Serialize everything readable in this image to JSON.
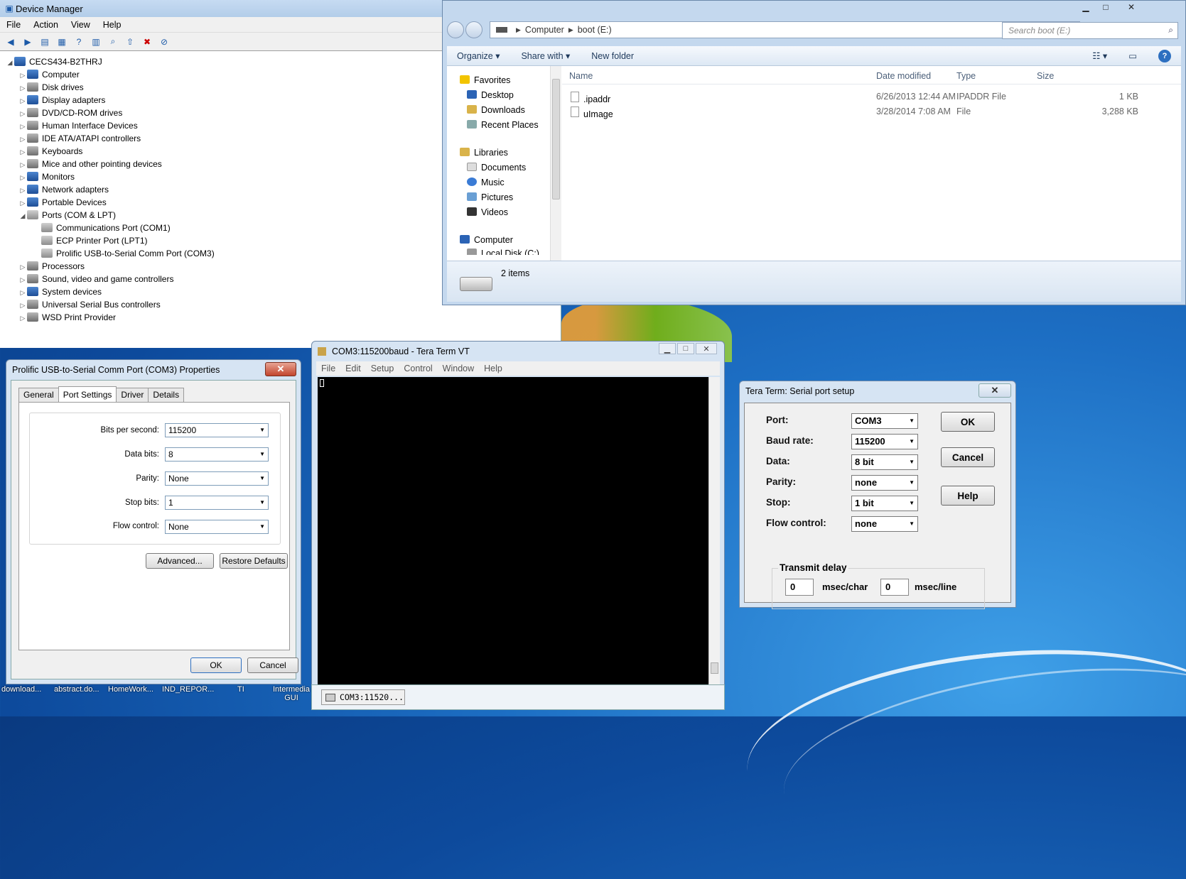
{
  "desktop": {
    "icons": [
      {
        "label": "download..."
      },
      {
        "label": "abstract.do..."
      },
      {
        "label": "HomeWork..."
      },
      {
        "label": "IND_REPOR..."
      },
      {
        "label": "TI"
      },
      {
        "label": "Intermedia GUI"
      }
    ]
  },
  "device_manager": {
    "title": "Device Manager",
    "menu": [
      "File",
      "Action",
      "View",
      "Help"
    ],
    "toolbar_icons": [
      "back-icon",
      "forward-icon",
      "up-icon",
      "properties-icon",
      "help-icon",
      "details-icon",
      "scan-icon",
      "update-driver-icon",
      "uninstall-icon",
      "disable-icon"
    ],
    "root": "CECS434-B2THRJ",
    "categories": [
      "Computer",
      "Disk drives",
      "Display adapters",
      "DVD/CD-ROM drives",
      "Human Interface Devices",
      "IDE ATA/ATAPI controllers",
      "Keyboards",
      "Mice and other pointing devices",
      "Monitors",
      "Network adapters",
      "Portable Devices",
      "Ports (COM & LPT)"
    ],
    "ports": [
      "Communications Port (COM1)",
      "ECP Printer Port (LPT1)",
      "Prolific USB-to-Serial Comm Port (COM3)"
    ],
    "categories_after": [
      "Processors",
      "Sound, video and game controllers",
      "System devices",
      "Universal Serial Bus controllers",
      "WSD Print Provider"
    ]
  },
  "explorer": {
    "breadcrumb": [
      "Computer",
      "boot (E:)"
    ],
    "search_placeholder": "Search boot (E:)",
    "commands": [
      "Organize ▾",
      "Share with ▾",
      "New folder"
    ],
    "nav": {
      "favorites": "Favorites",
      "favorite_items": [
        "Desktop",
        "Downloads",
        "Recent Places"
      ],
      "libraries": "Libraries",
      "library_items": [
        "Documents",
        "Music",
        "Pictures",
        "Videos"
      ],
      "computer": "Computer",
      "computer_items": [
        "Local Disk (C:)"
      ]
    },
    "columns": [
      "Name",
      "Date modified",
      "Type",
      "Size"
    ],
    "files": [
      {
        "name": ".ipaddr",
        "date": "6/26/2013 12:44 AM",
        "type": "IPADDR File",
        "size": "1 KB"
      },
      {
        "name": "uImage",
        "date": "3/28/2014 7:08 AM",
        "type": "File",
        "size": "3,288 KB"
      }
    ],
    "status": "2 items"
  },
  "properties": {
    "title": "Prolific USB-to-Serial Comm Port (COM3) Properties",
    "tabs": [
      "General",
      "Port Settings",
      "Driver",
      "Details"
    ],
    "active_tab": "Port Settings",
    "fields": [
      {
        "label": "Bits per second:",
        "value": "115200"
      },
      {
        "label": "Data bits:",
        "value": "8"
      },
      {
        "label": "Parity:",
        "value": "None"
      },
      {
        "label": "Stop bits:",
        "value": "1"
      },
      {
        "label": "Flow control:",
        "value": "None"
      }
    ],
    "advanced": "Advanced...",
    "restore": "Restore Defaults",
    "ok": "OK",
    "cancel": "Cancel",
    "close": "✕"
  },
  "teraterm": {
    "title": "COM3:115200baud - Tera Term VT",
    "menu": [
      "File",
      "Edit",
      "Setup",
      "Control",
      "Window",
      "Help"
    ],
    "taskbar_label": "COM3:11520..."
  },
  "serial_setup": {
    "title": "Tera Term: Serial port setup",
    "fields": [
      {
        "label": "Port:",
        "value": "COM3"
      },
      {
        "label": "Baud rate:",
        "value": "115200"
      },
      {
        "label": "Data:",
        "value": "8 bit"
      },
      {
        "label": "Parity:",
        "value": "none"
      },
      {
        "label": "Stop:",
        "value": "1 bit"
      },
      {
        "label": "Flow control:",
        "value": "none"
      }
    ],
    "ok": "OK",
    "cancel": "Cancel",
    "help": "Help",
    "transmit_delay": "Transmit delay",
    "char_delay": "0",
    "char_unit": "msec/char",
    "line_delay": "0",
    "line_unit": "msec/line",
    "close": "✕"
  }
}
